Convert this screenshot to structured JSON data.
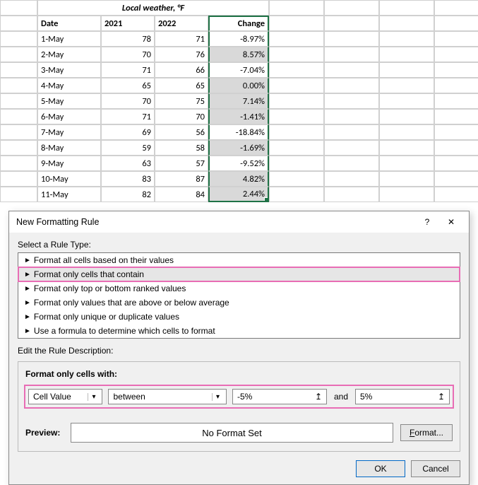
{
  "spreadsheet": {
    "title": "Local weather, °F",
    "columns": [
      "Date",
      "2021",
      "2022",
      "Change"
    ],
    "rows": [
      {
        "date": "1-May",
        "y2021": "78",
        "y2022": "71",
        "change": "-8.97%",
        "shaded": false
      },
      {
        "date": "2-May",
        "y2021": "70",
        "y2022": "76",
        "change": "8.57%",
        "shaded": true
      },
      {
        "date": "3-May",
        "y2021": "71",
        "y2022": "66",
        "change": "-7.04%",
        "shaded": false
      },
      {
        "date": "4-May",
        "y2021": "65",
        "y2022": "65",
        "change": "0.00%",
        "shaded": true
      },
      {
        "date": "5-May",
        "y2021": "70",
        "y2022": "75",
        "change": "7.14%",
        "shaded": true
      },
      {
        "date": "6-May",
        "y2021": "71",
        "y2022": "70",
        "change": "-1.41%",
        "shaded": true
      },
      {
        "date": "7-May",
        "y2021": "69",
        "y2022": "56",
        "change": "-18.84%",
        "shaded": false
      },
      {
        "date": "8-May",
        "y2021": "59",
        "y2022": "58",
        "change": "-1.69%",
        "shaded": true
      },
      {
        "date": "9-May",
        "y2021": "63",
        "y2022": "57",
        "change": "-9.52%",
        "shaded": false
      },
      {
        "date": "10-May",
        "y2021": "83",
        "y2022": "87",
        "change": "4.82%",
        "shaded": true
      },
      {
        "date": "11-May",
        "y2021": "82",
        "y2022": "84",
        "change": "2.44%",
        "shaded": true
      }
    ]
  },
  "dialog": {
    "title": "New Formatting Rule",
    "help_symbol": "?",
    "close_symbol": "✕",
    "select_rule_label": "Select a Rule Type:",
    "rule_types": [
      "Format all cells based on their values",
      "Format only cells that contain",
      "Format only top or bottom ranked values",
      "Format only values that are above or below average",
      "Format only unique or duplicate values",
      "Use a formula to determine which cells to format"
    ],
    "selected_rule_index": 1,
    "edit_desc_label": "Edit the Rule Description:",
    "cells_with_label": "Format only cells with:",
    "criteria": {
      "field": "Cell Value",
      "operator": "between",
      "value1": "-5%",
      "and_label": "and",
      "value2": "5%"
    },
    "preview_label": "Preview:",
    "preview_text": "No Format Set",
    "format_btn": "Format...",
    "ok_btn": "OK",
    "cancel_btn": "Cancel"
  }
}
